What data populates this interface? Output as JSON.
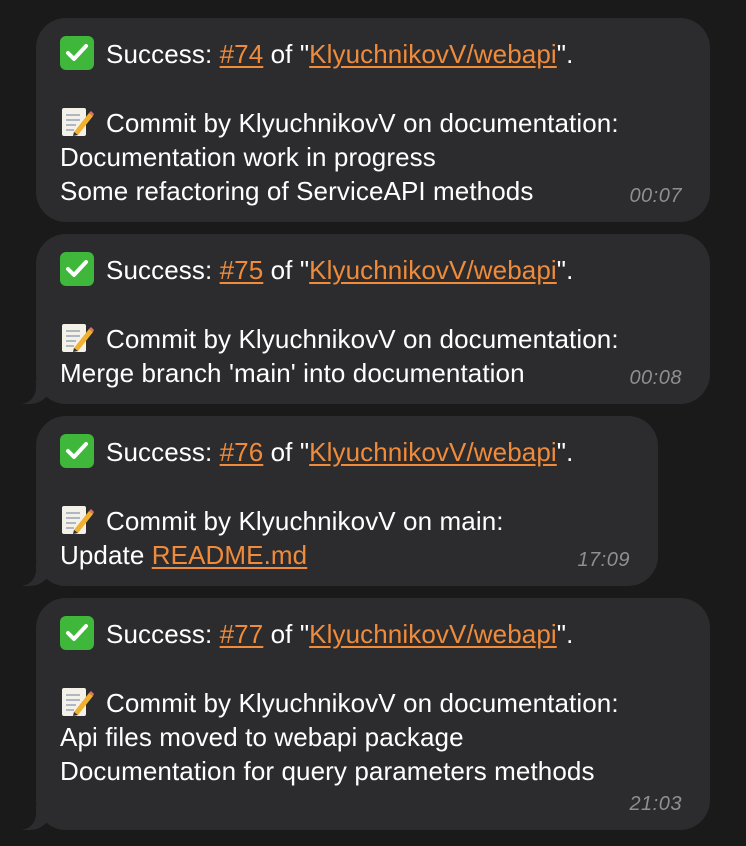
{
  "messages": [
    {
      "status_label": "Success: ",
      "run_number": "#74",
      "of_text": " of \"",
      "repo": "KlyuchnikovV/webapi",
      "closing": "\".",
      "commit_header": "Commit by KlyuchnikovV on documentation:",
      "body_lines": [
        "Documentation work in progress",
        "Some refactoring of ServiceAPI methods"
      ],
      "time": "00:07"
    },
    {
      "status_label": "Success: ",
      "run_number": "#75",
      "of_text": " of \"",
      "repo": "KlyuchnikovV/webapi",
      "closing": "\".",
      "commit_header": "Commit by KlyuchnikovV on documentation:",
      "body_lines": [
        "Merge branch 'main' into documentation"
      ],
      "time": "00:08"
    },
    {
      "status_label": "Success: ",
      "run_number": "#76",
      "of_text": " of \"",
      "repo": "KlyuchnikovV/webapi",
      "closing": "\".",
      "commit_header": "Commit by KlyuchnikovV on main:",
      "body_prefix": "Update ",
      "body_link": "README.md",
      "time": "17:09"
    },
    {
      "status_label": "Success: ",
      "run_number": "#77",
      "of_text": " of \"",
      "repo": "KlyuchnikovV/webapi",
      "closing": "\".",
      "commit_header": "Commit by KlyuchnikovV on documentation:",
      "body_lines": [
        "Api files moved to webapi package",
        "Documentation for query parameters methods"
      ],
      "time": "21:03"
    }
  ],
  "icons": {
    "status": "check-mark-button-icon",
    "commit": "memo-pencil-icon"
  },
  "colors": {
    "background": "#1a1a1a",
    "bubble": "#2c2c2e",
    "link": "#ef8b3a",
    "timestamp": "#8e8e93",
    "check": "#3fb73b"
  }
}
